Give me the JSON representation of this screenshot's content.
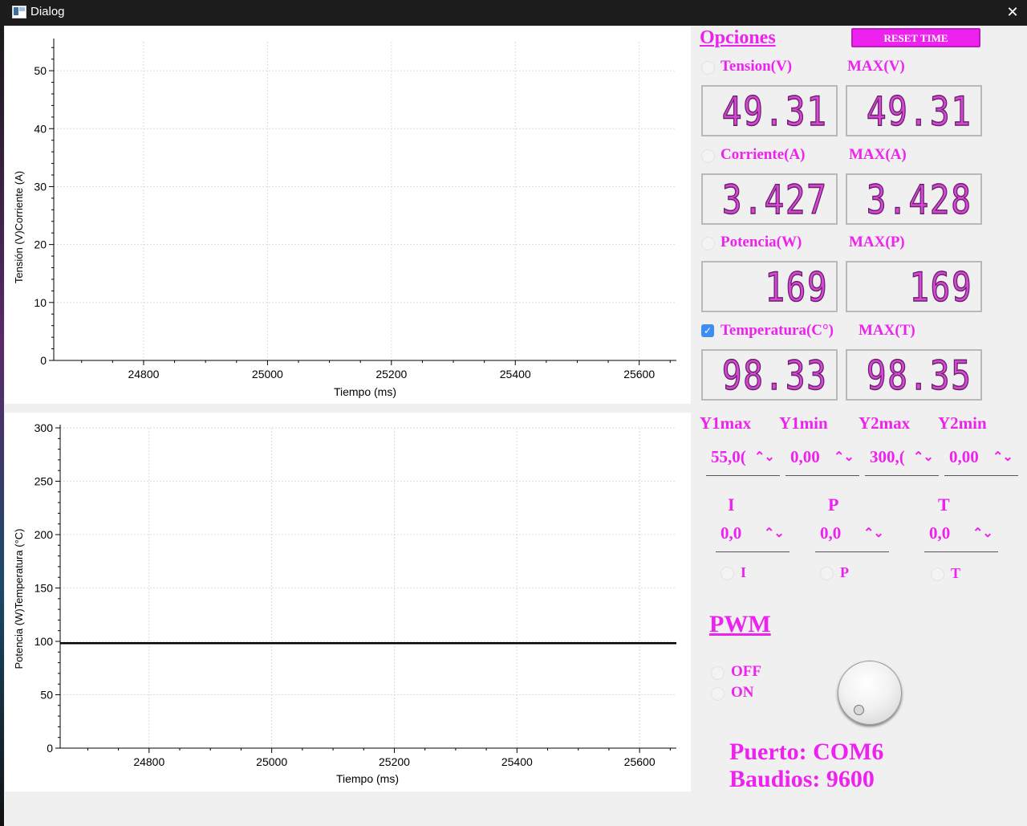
{
  "window": {
    "title": "Dialog",
    "close_symbol": "✕"
  },
  "chart1": {
    "ylabel": "Tensión (V)Corriente (A)",
    "xlabel": "Tiempo (ms)"
  },
  "chart2": {
    "ylabel": "Potencia (W)Temperatura (°C)",
    "xlabel": "Tiempo (ms)"
  },
  "chart_data": [
    {
      "type": "line",
      "title": "",
      "xlabel": "Tiempo (ms)",
      "ylabel": "Tensión (V)Corriente (A)",
      "xlim": [
        24655,
        25660
      ],
      "ylim": [
        0,
        55
      ],
      "x_ticks": [
        24800,
        25000,
        25200,
        25400,
        25600
      ],
      "y_ticks": [
        0,
        10,
        20,
        30,
        40,
        50
      ],
      "grid": true,
      "series": []
    },
    {
      "type": "line",
      "title": "",
      "xlabel": "Tiempo (ms)",
      "ylabel": "Potencia (W)Temperatura (°C)",
      "xlim": [
        24655,
        25660
      ],
      "ylim": [
        0,
        300
      ],
      "x_ticks": [
        24800,
        25000,
        25200,
        25400,
        25600
      ],
      "y_ticks": [
        0,
        50,
        100,
        150,
        200,
        250,
        300
      ],
      "grid": true,
      "series": [
        {
          "x": [
            24655,
            25660
          ],
          "y": [
            98.33,
            98.33
          ],
          "color": "#000000"
        }
      ]
    }
  ],
  "options": {
    "title": "Opciones",
    "reset_label": "RESET TIME",
    "tension": {
      "label": "Tension(V)",
      "max_label": "MAX(V)",
      "value": "49.31",
      "max_value": "49.31",
      "checked": false
    },
    "corriente": {
      "label": "Corriente(A)",
      "max_label": "MAX(A)",
      "value": "3.427",
      "max_value": "3.428",
      "checked": false
    },
    "potencia": {
      "label": "Potencia(W)",
      "max_label": "MAX(P)",
      "value": "169",
      "max_value": "169",
      "checked": false
    },
    "temperatura": {
      "label": "Temperatura(C°)",
      "max_label": "MAX(T)",
      "value": "98.33",
      "max_value": "98.35",
      "checked": true
    }
  },
  "limits": {
    "y1max": {
      "label": "Y1max",
      "value": "55,0("
    },
    "y1min": {
      "label": "Y1min",
      "value": "0,00"
    },
    "y2max": {
      "label": "Y2max",
      "value": "300,("
    },
    "y2min": {
      "label": "Y2min",
      "value": "0,00"
    }
  },
  "offsets": {
    "i": {
      "label": "I",
      "value": "0,0",
      "radio_label": "I"
    },
    "p": {
      "label": "P",
      "value": "0,0",
      "radio_label": "P"
    },
    "t": {
      "label": "T",
      "value": "0,0",
      "radio_label": "T"
    }
  },
  "spin_arrows": "⌃⌄",
  "pwm": {
    "title": "PWM",
    "off_label": "OFF",
    "on_label": "ON"
  },
  "port": {
    "puerto": "Puerto: COM6",
    "baudios": "Baudios: 9600"
  },
  "colors": {
    "accent": "#ee22ee",
    "lcd_digit": "#d548d5",
    "checkbox": "#3d8ef0"
  }
}
